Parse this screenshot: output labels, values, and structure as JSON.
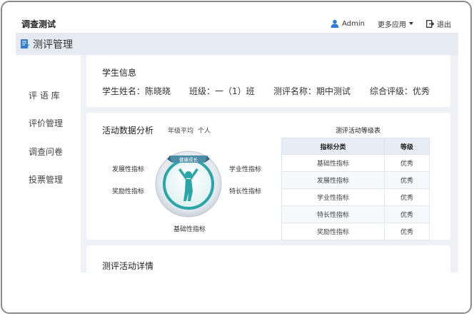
{
  "app": {
    "title": "调查测试"
  },
  "topnav": {
    "user": "Admin",
    "more_apps": "更多应用",
    "logout": "退出"
  },
  "subheader": {
    "title": "测评管理"
  },
  "sidebar": {
    "items": [
      {
        "label": "评 语 库"
      },
      {
        "label": "评价管理"
      },
      {
        "label": "调查问卷"
      },
      {
        "label": "投票管理"
      }
    ]
  },
  "student": {
    "section_title": "学生信息",
    "name": "学生姓名：陈晓晓",
    "class": "班级：一（1）班",
    "test": "测评名称：期中测试",
    "grade": "综合评级：优秀"
  },
  "analysis": {
    "title": "活动数据分析",
    "tabs": [
      "年级平均",
      "个人"
    ],
    "emblem_text": "健康成长",
    "indicators": {
      "left_top": "发展性指标",
      "left_bottom": "奖励性指标",
      "right_top": "学业性指标",
      "right_bottom": "特长性指标",
      "bottom": "基础性指标"
    }
  },
  "grade_table": {
    "caption": "测评活动等级表",
    "headers": [
      "指标分类",
      "等级"
    ],
    "rows": [
      [
        "基础性指标",
        "优秀"
      ],
      [
        "发展性指标",
        "优秀"
      ],
      [
        "学业性指标",
        "优秀"
      ],
      [
        "特长性指标",
        "优秀"
      ],
      [
        "奖励性指标",
        "优秀"
      ]
    ]
  },
  "details": {
    "title": "测评活动详情"
  },
  "colors": {
    "accent": "#2e7ed2",
    "emblem": "#2aa6a8",
    "background": "#eef1f6"
  }
}
